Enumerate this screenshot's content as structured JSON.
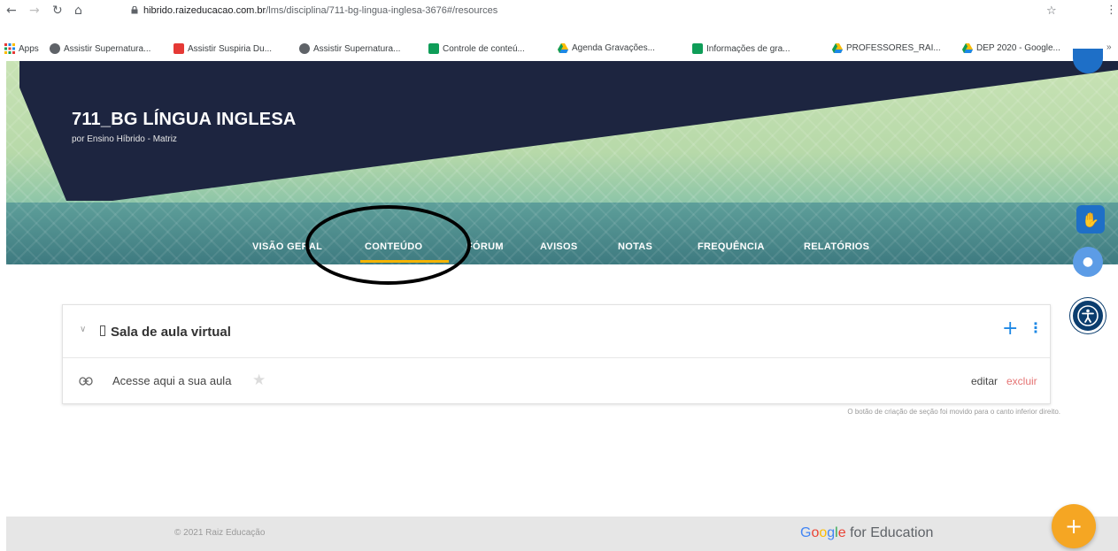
{
  "browser": {
    "url_host": "hibrido.raizeducacao.com.br",
    "url_path": "/lms/disciplina/711-bg-lingua-inglesa-3676#/resources"
  },
  "bookmarks": [
    {
      "label": "Apps",
      "icon": "apps-grid-icon",
      "color": "#e53935"
    },
    {
      "label": "Assistir Supernatura...",
      "icon": "globe-icon",
      "color": "#5f6368"
    },
    {
      "label": "Assistir Suspiria Du...",
      "icon": "opera-icon",
      "color": "#e53935"
    },
    {
      "label": "Assistir Supernatura...",
      "icon": "globe-icon",
      "color": "#5f6368"
    },
    {
      "label": "Controle de conteú...",
      "icon": "sheets-icon",
      "color": "#0f9d58"
    },
    {
      "label": "Agenda Gravações...",
      "icon": "drive-icon",
      "color": "#fbbc04"
    },
    {
      "label": "Informações de gra...",
      "icon": "sheets-icon",
      "color": "#0f9d58"
    },
    {
      "label": "PROFESSORES_RAI...",
      "icon": "drive-icon",
      "color": "#fbbc04"
    },
    {
      "label": "DEP 2020 - Google...",
      "icon": "drive-icon",
      "color": "#fbbc04"
    }
  ],
  "course": {
    "title": "711_BG LÍNGUA INGLESA",
    "subtitle": "por Ensino Híbrido - Matriz"
  },
  "tabs": [
    {
      "label": "VISÃO GERAL",
      "active": false
    },
    {
      "label": "CONTEÚDO",
      "active": true
    },
    {
      "label": "FÓRUM",
      "active": false
    },
    {
      "label": "AVISOS",
      "active": false
    },
    {
      "label": "NOTAS",
      "active": false
    },
    {
      "label": "FREQUÊNCIA",
      "active": false
    },
    {
      "label": "RELATÓRIOS",
      "active": false
    }
  ],
  "section": {
    "title": "Sala de aula virtual",
    "items": [
      {
        "label": "Acesse aqui a sua aula",
        "edit_label": "editar",
        "delete_label": "excluir"
      }
    ],
    "hint": "O botão de criação de seção foi movido para o canto inferior direito."
  },
  "footer": {
    "copyright": "© 2021 Raiz Educação",
    "brand_google": "Google",
    "brand_rest": " for Education"
  },
  "colors": {
    "accent_blue": "#1e88e5",
    "tab_active_underline": "#f5b400",
    "fab": "#f5a623",
    "delete": "#e57373",
    "hero_dark": "#1d2540"
  }
}
